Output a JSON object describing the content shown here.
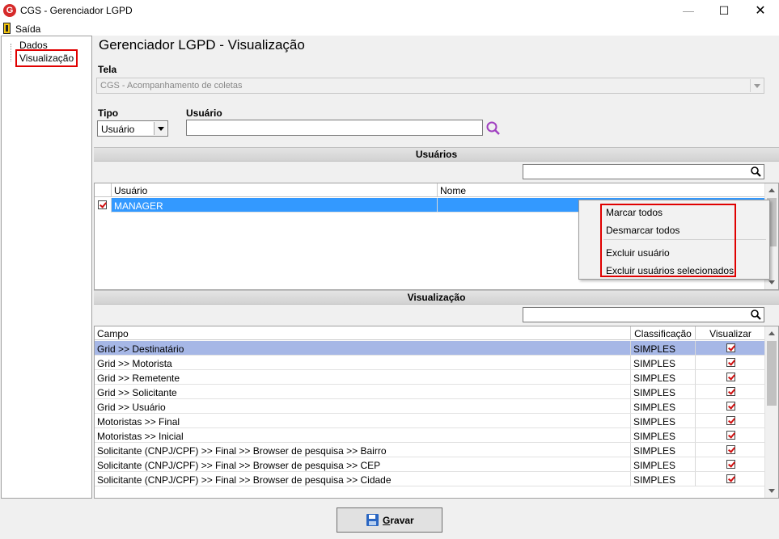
{
  "window": {
    "title": "CGS - Gerenciador LGPD",
    "icon_letter": "G",
    "minimize": "—",
    "maximize": "☐",
    "close": "✕"
  },
  "menu": {
    "exit_label": "Saída"
  },
  "tree": {
    "items": [
      "Dados",
      "Visualização"
    ]
  },
  "page": {
    "title": "Gerenciador LGPD - Visualização"
  },
  "form": {
    "tela_label": "Tela",
    "tela_value": "CGS - Acompanhamento de coletas",
    "tipo_label": "Tipo",
    "tipo_value": "Usuário",
    "usuario_label": "Usuário",
    "usuario_value": ""
  },
  "usuarios": {
    "section_title": "Usuários",
    "columns": [
      "Usuário",
      "Nome"
    ],
    "rows": [
      {
        "usuario": "MANAGER",
        "nome": "",
        "checked": true
      }
    ]
  },
  "context_menu": {
    "items": [
      "Marcar todos",
      "Desmarcar todos",
      "Excluir usuário",
      "Excluir usuários selecionados"
    ]
  },
  "visualizacao": {
    "section_title": "Visualização",
    "columns": [
      "Campo",
      "Classificação",
      "Visualizar"
    ],
    "rows": [
      {
        "campo": "Grid >> Destinatário",
        "classificacao": "SIMPLES",
        "visualizar": true
      },
      {
        "campo": "Grid >> Motorista",
        "classificacao": "SIMPLES",
        "visualizar": true
      },
      {
        "campo": "Grid >> Remetente",
        "classificacao": "SIMPLES",
        "visualizar": true
      },
      {
        "campo": "Grid >> Solicitante",
        "classificacao": "SIMPLES",
        "visualizar": true
      },
      {
        "campo": "Grid >> Usuário",
        "classificacao": "SIMPLES",
        "visualizar": true
      },
      {
        "campo": "Motoristas >> Final",
        "classificacao": "SIMPLES",
        "visualizar": true
      },
      {
        "campo": "Motoristas >> Inicial",
        "classificacao": "SIMPLES",
        "visualizar": true
      },
      {
        "campo": "Solicitante (CNPJ/CPF) >> Final >> Browser de pesquisa >> Bairro",
        "classificacao": "SIMPLES",
        "visualizar": true
      },
      {
        "campo": "Solicitante (CNPJ/CPF) >> Final >> Browser de pesquisa >> CEP",
        "classificacao": "SIMPLES",
        "visualizar": true
      },
      {
        "campo": "Solicitante (CNPJ/CPF) >> Final >> Browser de pesquisa >> Cidade",
        "classificacao": "SIMPLES",
        "visualizar": true
      }
    ]
  },
  "buttons": {
    "save_accel": "G",
    "save_rest": "ravar"
  },
  "colors": {
    "selection": "#3399ff",
    "highlight_box": "#e00000",
    "selected_row_soft": "#a6b7e6"
  }
}
